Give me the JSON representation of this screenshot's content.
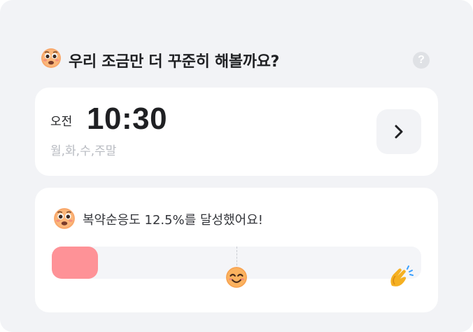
{
  "header": {
    "icon": "anxious-face-icon",
    "title": "우리 조금만 더 꾸준히 해볼까요?",
    "help_icon": "help-icon",
    "help_glyph": "?"
  },
  "alarm": {
    "ampm": "오전",
    "time": "10:30",
    "days": "월,화,수,주말",
    "action_icon": "chevron-right-icon"
  },
  "adherence": {
    "icon": "anxious-face-icon",
    "message": "복약순응도 12.5%를 달성했어요!",
    "progress_fraction": 0.125,
    "fill_color": "#fe9297",
    "milestone_icons": [
      "smiling-face-icon",
      "clapping-hands-icon"
    ]
  }
}
